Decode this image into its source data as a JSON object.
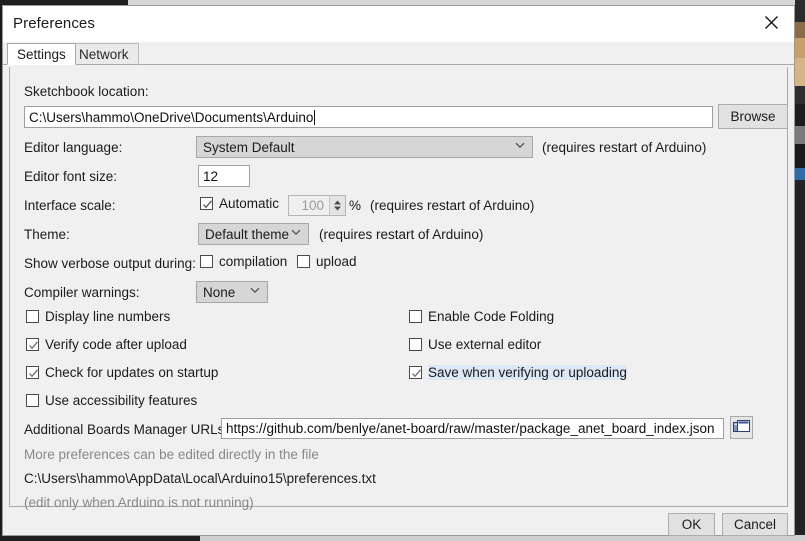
{
  "window": {
    "title": "Preferences",
    "close_icon": "close-icon"
  },
  "tabs": [
    {
      "label": "Settings",
      "active": true
    },
    {
      "label": "Network",
      "active": false
    }
  ],
  "settings": {
    "sketchbook": {
      "label": "Sketchbook location:",
      "value": "C:\\Users\\hammo\\OneDrive\\Documents\\Arduino",
      "browse_label": "Browse"
    },
    "editor_language": {
      "label": "Editor language:",
      "value": "System Default",
      "note": "(requires restart of Arduino)"
    },
    "editor_font_size": {
      "label": "Editor font size:",
      "value": "12"
    },
    "interface_scale": {
      "label": "Interface scale:",
      "automatic_label": "Automatic",
      "automatic_checked": true,
      "scale_value": "100",
      "percent_label": "%",
      "note": "(requires restart of Arduino)"
    },
    "theme": {
      "label": "Theme:",
      "value": "Default theme",
      "note": "(requires restart of Arduino)"
    },
    "verbose": {
      "label": "Show verbose output during:",
      "compilation_label": "compilation",
      "compilation_checked": false,
      "upload_label": "upload",
      "upload_checked": false
    },
    "compiler_warnings": {
      "label": "Compiler warnings:",
      "value": "None"
    },
    "checkboxes_left": [
      {
        "label": "Display line numbers",
        "checked": false
      },
      {
        "label": "Verify code after upload",
        "checked": true
      },
      {
        "label": "Check for updates on startup",
        "checked": true
      },
      {
        "label": "Use accessibility features",
        "checked": false
      }
    ],
    "checkboxes_right": [
      {
        "label": "Enable Code Folding",
        "checked": false
      },
      {
        "label": "Use external editor",
        "checked": false
      },
      {
        "label": "Save when verifying or uploading",
        "checked": true,
        "highlighted": true
      }
    ],
    "boards_urls": {
      "label": "Additional Boards Manager URLs:",
      "value": "https://github.com/benlye/anet-board/raw/master/package_anet_board_index.json",
      "expand_icon": "multi-window-icon"
    },
    "more_prefs_note": "More preferences can be edited directly in the file",
    "prefs_path": "C:\\Users\\hammo\\AppData\\Local\\Arduino15\\preferences.txt",
    "edit_note": "(edit only when Arduino is not running)"
  },
  "footer": {
    "ok_label": "OK",
    "cancel_label": "Cancel"
  },
  "colors": {
    "dialog_bg": "#f0f0f0",
    "titlebar_bg": "#ffffff",
    "field_bg": "#ffffff",
    "combo_bg": "#d6d6d6",
    "button_bg": "#e1e1e1",
    "muted_text": "#888888",
    "highlight": "#dce8f5"
  }
}
